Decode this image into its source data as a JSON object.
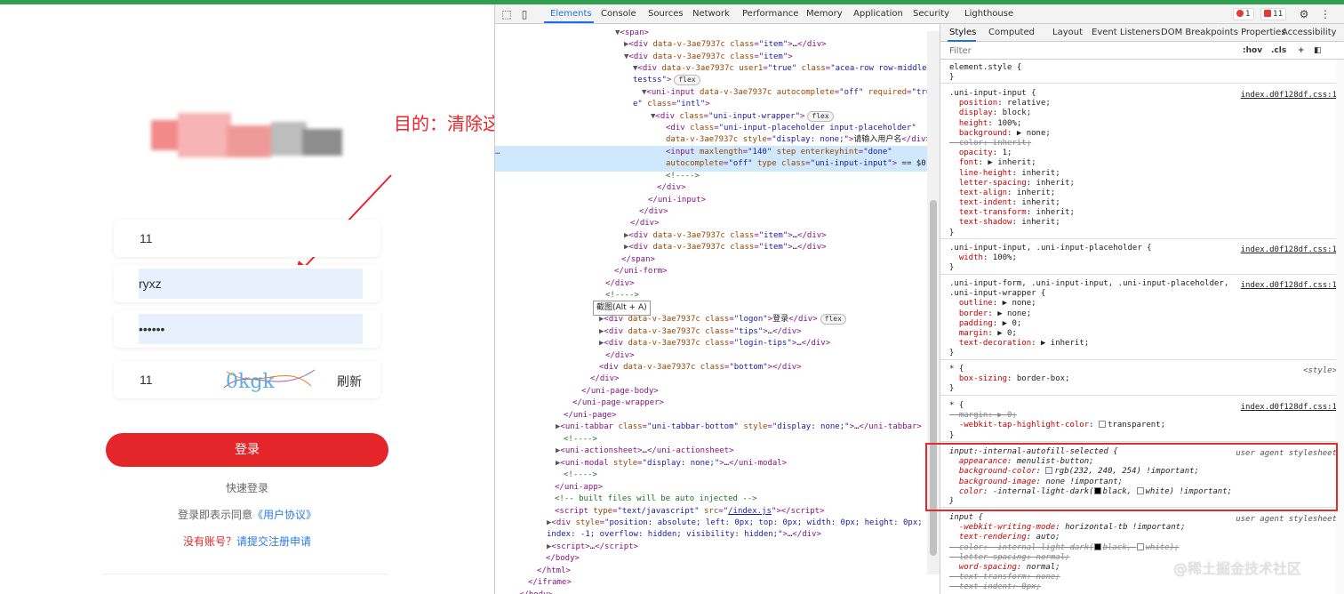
{
  "app": {
    "annotation": "目的：清除这个背景颜色",
    "fields": [
      {
        "value": "11"
      },
      {
        "value": "ryxz"
      },
      {
        "value": "••••••"
      },
      {
        "value": "11"
      }
    ],
    "captcha_text": "0kgk",
    "refresh_label": "刷新",
    "login_label": "登录",
    "quick_login": "快速登录",
    "agree_prefix": "登录即表示同意",
    "agree_link": "《用户协议》",
    "register_question": "没有账号？",
    "register_link": "请提交注册申请"
  },
  "devtools": {
    "tabs": [
      "Elements",
      "Console",
      "Sources",
      "Network",
      "Performance",
      "Memory",
      "Application",
      "Security",
      "Lighthouse"
    ],
    "errors": "1",
    "warnings": "11",
    "tooltip": "截图(Alt + A)",
    "styles_tabs": [
      "Styles",
      "Computed",
      "Layout",
      "Event Listeners",
      "DOM Breakpoints",
      "Properties",
      "Accessibility"
    ],
    "filter_placeholder": "Filter",
    "filter_hov": ":hov",
    "filter_cls": ".cls",
    "watermark": "@稀土掘金技术社区",
    "colors": {
      "accent": "#1a73e8",
      "autofill": "#e8f0fe",
      "annotation": "#e8242b",
      "login": "#e4262a"
    }
  }
}
